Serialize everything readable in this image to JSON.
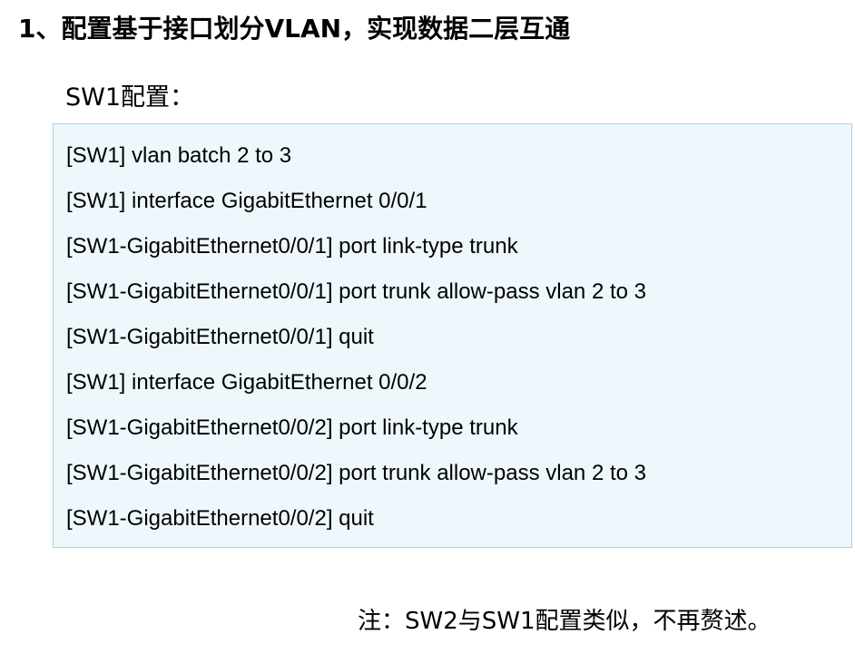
{
  "heading": "1、配置基于接口划分VLAN，实现数据二层互通",
  "subheading": "SW1配置：",
  "code_lines": [
    "[SW1] vlan batch 2 to 3",
    "[SW1] interface GigabitEthernet 0/0/1",
    "[SW1-GigabitEthernet0/0/1] port link-type trunk",
    "[SW1-GigabitEthernet0/0/1] port trunk allow-pass vlan 2 to 3",
    "[SW1-GigabitEthernet0/0/1] quit",
    "[SW1] interface GigabitEthernet 0/0/2",
    "[SW1-GigabitEthernet0/0/2] port link-type trunk",
    "[SW1-GigabitEthernet0/0/2] port trunk allow-pass vlan 2 to 3",
    "[SW1-GigabitEthernet0/0/2] quit"
  ],
  "note": "注：SW2与SW1配置类似，不再赘述。",
  "colors": {
    "code_background": "#eef8fc",
    "code_border": "#9ed8ee"
  }
}
